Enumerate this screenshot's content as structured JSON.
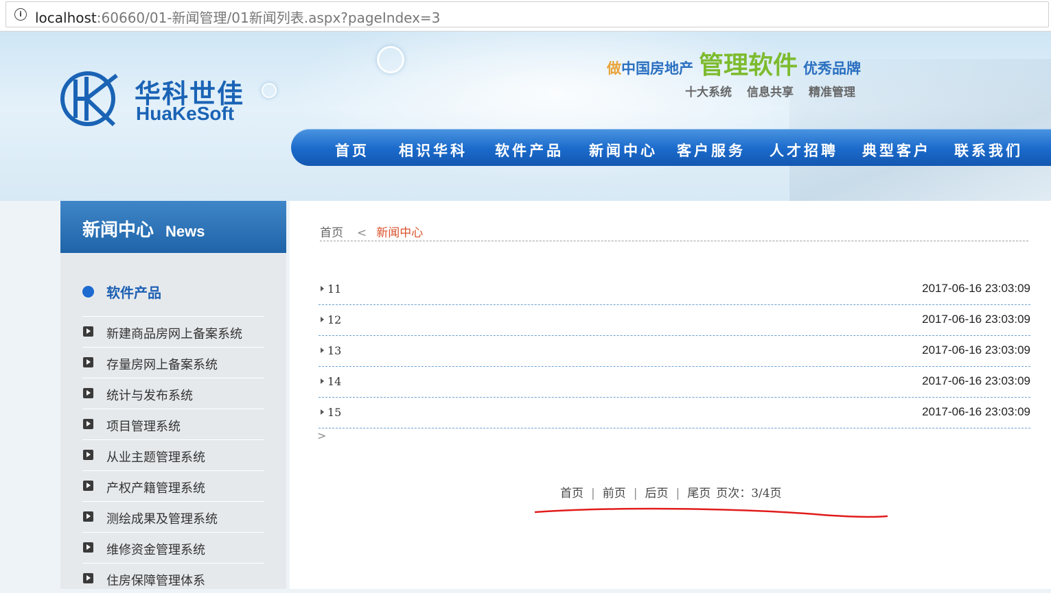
{
  "address_bar": {
    "url_host": "localhost",
    "url_rest": ":60660/01-新闻管理/01新闻列表.aspx?pageIndex=3"
  },
  "banner": {
    "logo_cn": "华科世佳",
    "logo_en": "HuaKeSoft",
    "slogan_prefix": "做",
    "slogan_part1": "中国房地产",
    "slogan_big": "管理软件",
    "slogan_part2": "优秀品牌",
    "subslogan": [
      "十大系统",
      "信息共享",
      "精准管理"
    ],
    "brand_blue": "#1a63b5",
    "accent_green": "#7dbb2e"
  },
  "nav": {
    "items": [
      "首页",
      "相识华科",
      "软件产品",
      "新闻中心",
      "客户服务",
      "人才招聘",
      "典型客户",
      "联系我们"
    ]
  },
  "sidebar": {
    "title_cn": "新闻中心",
    "title_en": "News",
    "category": "软件产品",
    "items": [
      "新建商品房网上备案系统",
      "存量房网上备案系统",
      "统计与发布系统",
      "项目管理系统",
      "从业主题管理系统",
      "产权产籍管理系统",
      "测绘成果及管理系统",
      "维修资金管理系统",
      "住房保障管理体系"
    ]
  },
  "breadcrumb": {
    "home": "首页",
    "separator": "<",
    "current": "新闻中心"
  },
  "news": [
    {
      "title": "11",
      "time": "2017-06-16 23:03:09"
    },
    {
      "title": "12",
      "time": "2017-06-16 23:03:09"
    },
    {
      "title": "13",
      "time": "2017-06-16 23:03:09"
    },
    {
      "title": "14",
      "time": "2017-06-16 23:03:09"
    },
    {
      "title": "15",
      "time": "2017-06-16 23:03:09"
    }
  ],
  "list_extra": ">",
  "pager": {
    "first": "首页",
    "prev": "前页",
    "next": "后页",
    "last": "尾页",
    "page_info": "页次：3/4页",
    "separator": "|"
  }
}
